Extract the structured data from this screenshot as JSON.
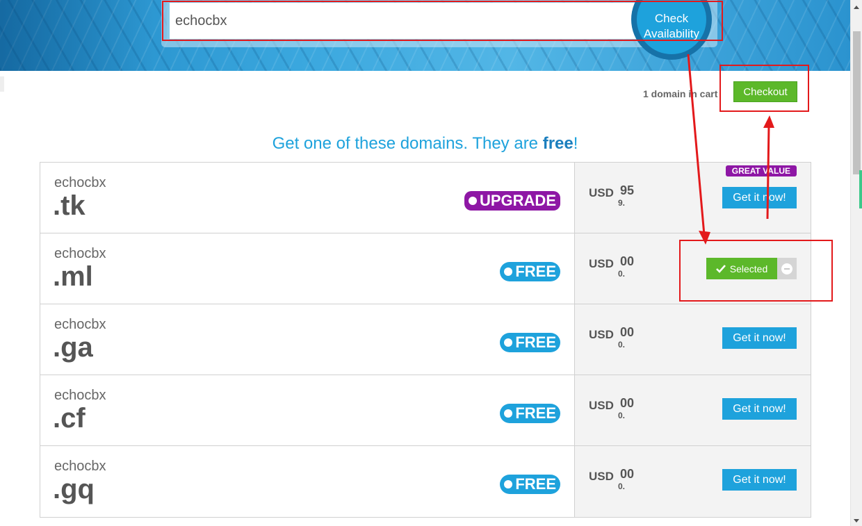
{
  "search": {
    "value": "echocbx",
    "button_line1": "Check",
    "button_line2": "Availability"
  },
  "cart": {
    "count_text": "1 domain in cart",
    "checkout_label": "Checkout"
  },
  "heading": {
    "prefix": "Get one of these domains. They are ",
    "emphasis": "free",
    "suffix": "!"
  },
  "domains": [
    {
      "sld": "echocbx",
      "tld": ".tk",
      "badge": "UPGRADE",
      "badge_type": "upgrade",
      "currency": "USD",
      "price_dec": "95",
      "price_int": "9.",
      "action": "Get it now!",
      "ribbon": "GREAT VALUE",
      "selected": false
    },
    {
      "sld": "echocbx",
      "tld": ".ml",
      "badge": "FREE",
      "badge_type": "free",
      "currency": "USD",
      "price_dec": "00",
      "price_int": "0.",
      "action": "Selected",
      "selected": true
    },
    {
      "sld": "echocbx",
      "tld": ".ga",
      "badge": "FREE",
      "badge_type": "free",
      "currency": "USD",
      "price_dec": "00",
      "price_int": "0.",
      "action": "Get it now!",
      "selected": false
    },
    {
      "sld": "echocbx",
      "tld": ".cf",
      "badge": "FREE",
      "badge_type": "free",
      "currency": "USD",
      "price_dec": "00",
      "price_int": "0.",
      "action": "Get it now!",
      "selected": false
    },
    {
      "sld": "echocbx",
      "tld": ".gq",
      "badge": "FREE",
      "badge_type": "free",
      "currency": "USD",
      "price_dec": "00",
      "price_int": "0.",
      "action": "Get it now!",
      "selected": false
    }
  ],
  "colors": {
    "accent_blue": "#1ea2dc",
    "success_green": "#5cb82a",
    "upgrade_purple": "#8e17a5",
    "annotation_red": "#e3191b"
  },
  "icons": {
    "selected": "check-icon",
    "remove": "minus-circle-icon"
  }
}
